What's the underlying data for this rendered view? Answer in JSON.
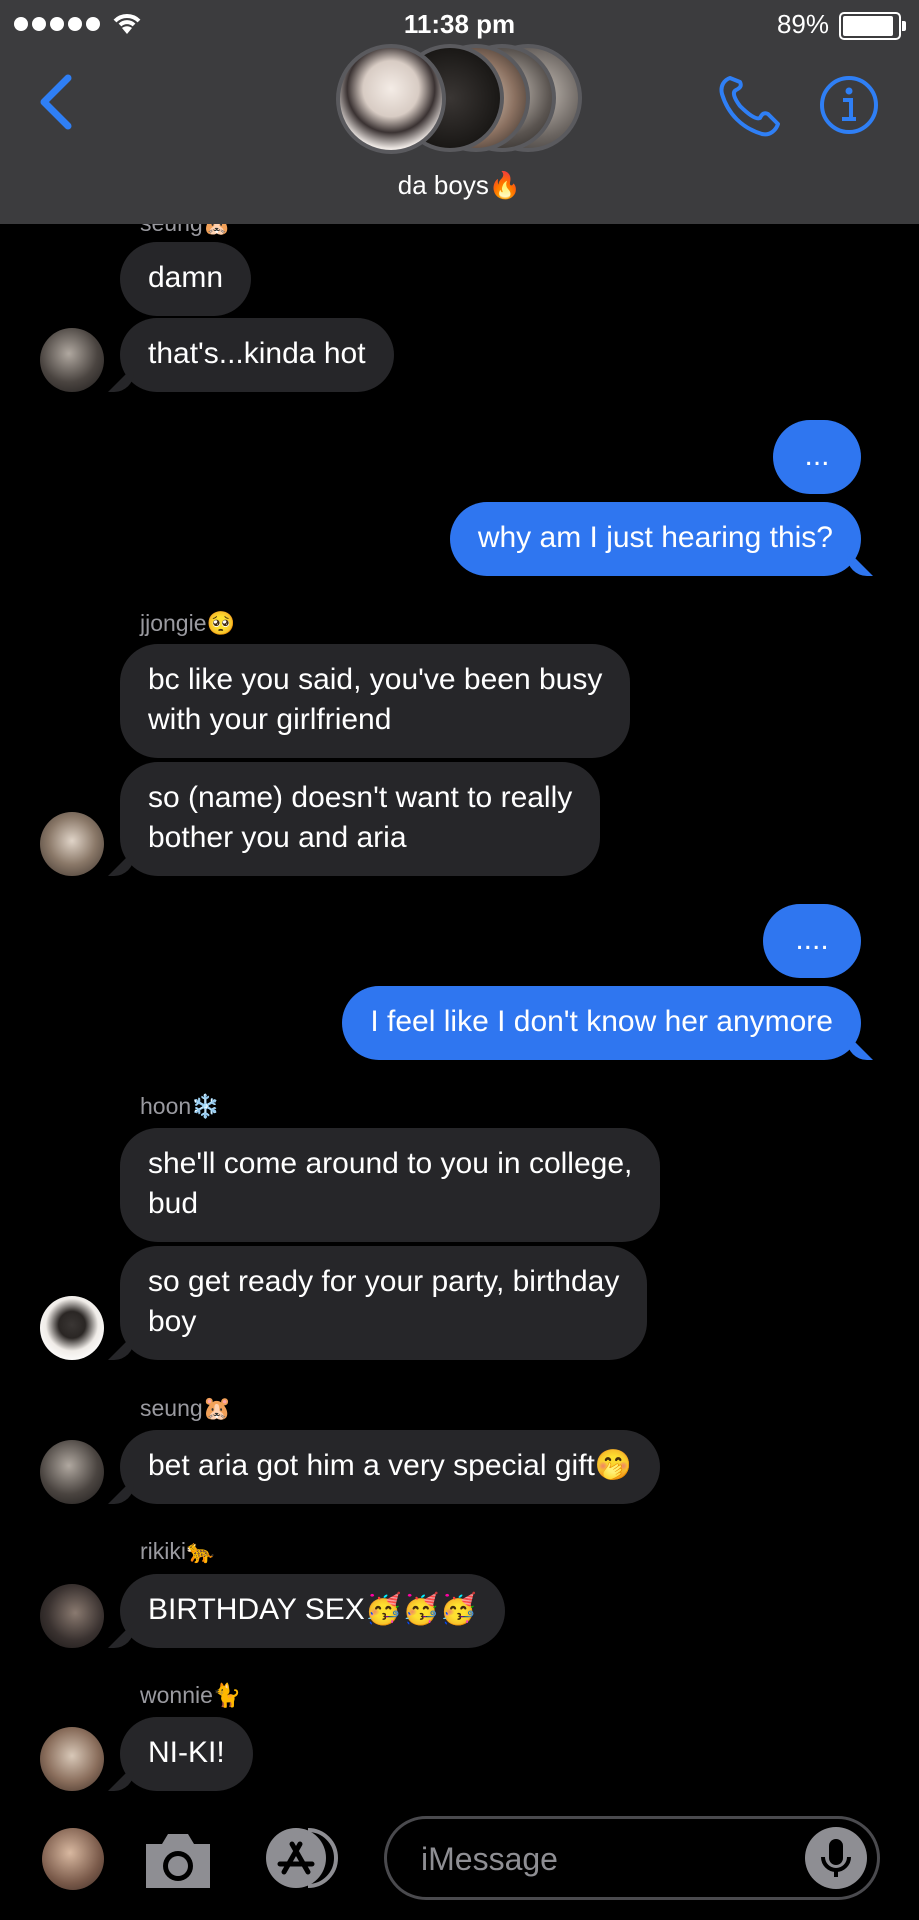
{
  "status_bar": {
    "time": "11:38 pm",
    "battery": "89%",
    "battery_level": 0.89
  },
  "header": {
    "group_name": "da boys🔥",
    "avatar_count": 5
  },
  "colors": {
    "sent": "#2f76f0",
    "received": "#262629",
    "header": "#3c3c3e",
    "accent": "#2f7ff5"
  },
  "messages": {
    "cut_sender": "seung🐹",
    "m1": "damn",
    "m2": "that's...kinda hot",
    "m3": "...",
    "m4": "why am I just hearing this?",
    "sender_jjongie": "jjongie🥺",
    "m5_l1": "bc like you said, you've been busy",
    "m5_l2": "with your girlfriend",
    "m6_l1": "so (name) doesn't want to really",
    "m6_l2": "bother you and aria",
    "m7": "....",
    "m8": "I feel like I don't know her anymore",
    "sender_hoon": "hoon❄️",
    "m9_l1": "she'll come around to you in college,",
    "m9_l2": "bud",
    "m10_l1": "so get ready for your party, birthday",
    "m10_l2": "boy",
    "sender_seung": "seung🐹",
    "m11": "bet aria got him a very special gift🤭",
    "sender_rikiki": "rikiki🐆",
    "m12": "BIRTHDAY SEX🥳🥳🥳",
    "sender_wonnie": "wonnie🐈",
    "m13": "NI-KI!"
  },
  "input": {
    "placeholder": "iMessage"
  },
  "icons": [
    "back-chevron-icon",
    "phone-icon",
    "info-icon",
    "camera-icon",
    "app-store-icon",
    "microphone-icon",
    "wifi-icon"
  ]
}
